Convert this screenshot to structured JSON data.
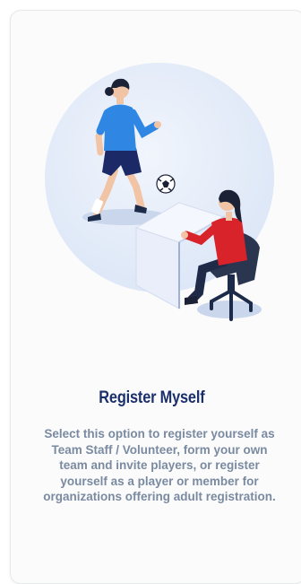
{
  "card": {
    "title": "Register Myself",
    "description": "Select this option to register yourself as Team Staff / Volunteer, form your own team and invite players, or register yourself as a player or member for organizations offering adult registration.",
    "illustration": {
      "subject": "register-myself-illustration",
      "icons": [
        "soccer-player-icon",
        "soccer-ball-icon",
        "seated-registrar-icon",
        "desk-icon",
        "office-chair-icon"
      ]
    }
  },
  "colors": {
    "title": "#1b2f6b",
    "description": "#7a8aa0",
    "card_background": "#fbfbfc",
    "circle_background": "#e3ecfa",
    "player_shirt": "#2f86e3",
    "registrar_shirt": "#d8232a"
  }
}
